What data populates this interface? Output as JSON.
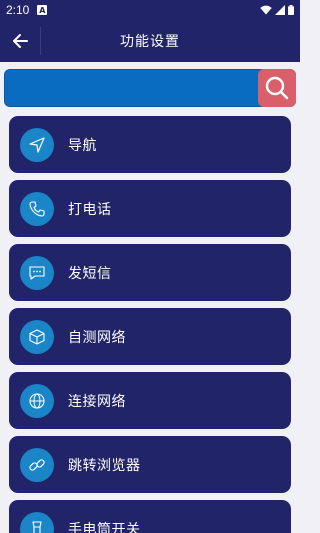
{
  "status": {
    "time": "2:10",
    "notif": "A"
  },
  "appbar": {
    "title": "功能设置"
  },
  "search": {
    "value": "",
    "placeholder": ""
  },
  "items": [
    {
      "label": "导航",
      "icon": "navigation-arrow-icon"
    },
    {
      "label": "打电话",
      "icon": "phone-icon"
    },
    {
      "label": "发短信",
      "icon": "message-icon"
    },
    {
      "label": "自测网络",
      "icon": "cube-network-icon"
    },
    {
      "label": "连接网络",
      "icon": "globe-network-icon"
    },
    {
      "label": "跳转浏览器",
      "icon": "link-icon"
    },
    {
      "label": "手电筒开关",
      "icon": "flashlight-icon"
    }
  ],
  "colors": {
    "primary": "#22246a",
    "accent": "#1a86c8",
    "search": "#0a6cc0",
    "search_button": "#d9606a",
    "background": "#f0f0f6"
  }
}
